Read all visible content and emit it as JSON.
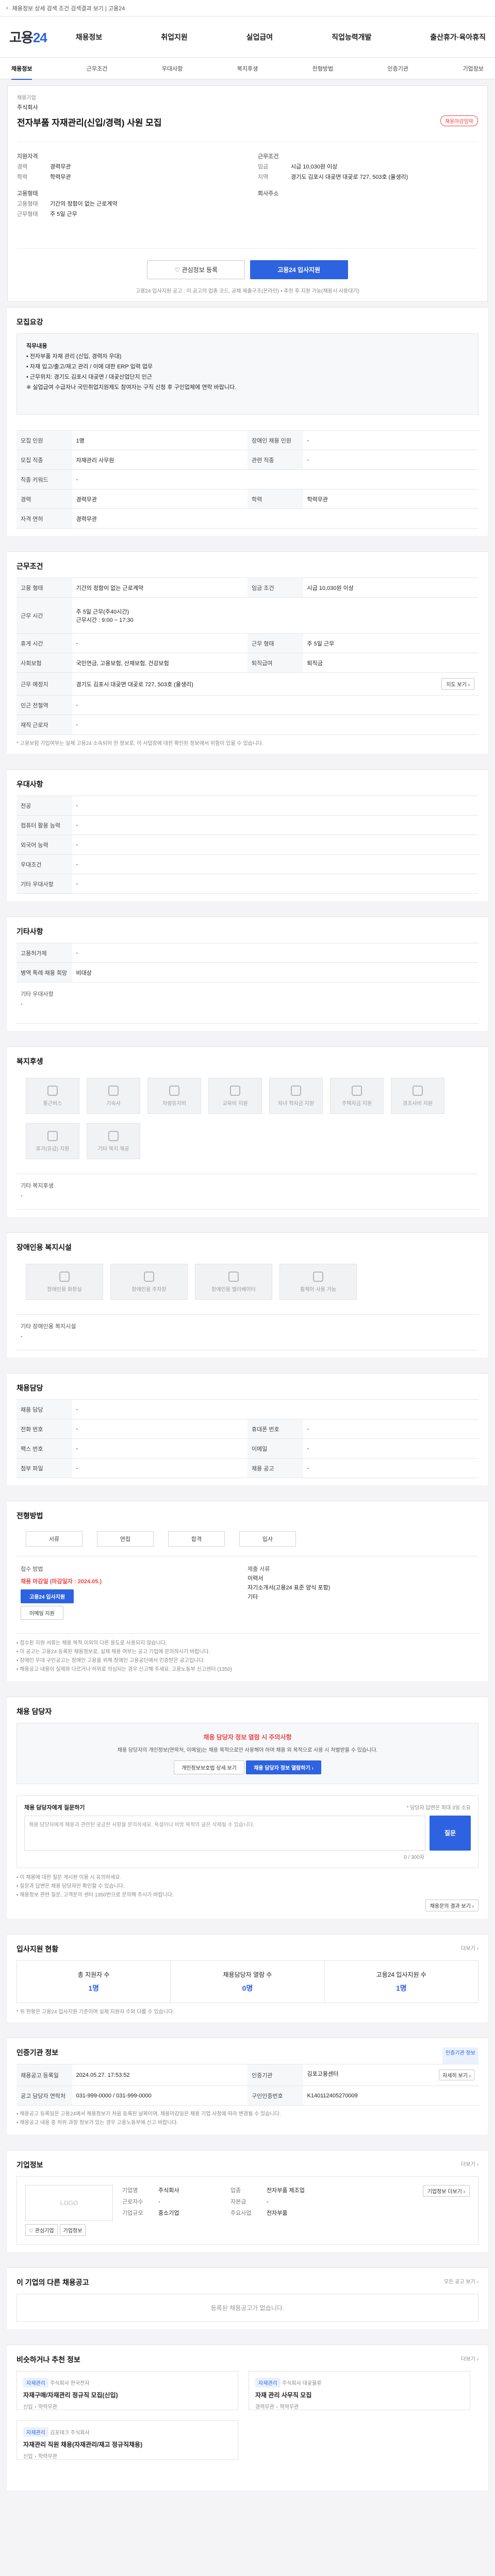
{
  "topbar": {
    "text": "채용정보 상세 검색 조건 검색결과 보기 | 고용24",
    "back": "‹"
  },
  "header": {
    "logo_a": "고용",
    "logo_b": "24",
    "menu": [
      "채용정보",
      "취업지원",
      "실업급여",
      "직업능력개발",
      "출산휴가·육아휴직"
    ]
  },
  "tabs": [
    "채용정보",
    "근무조건",
    "우대사항",
    "복지후생",
    "전형방법",
    "인증기관",
    "기업정보"
  ],
  "post": {
    "company_label": "채용기업",
    "company_name": "주식회사",
    "title": "전자부품 자재관리(신입/경력) 사원 모집",
    "badge": "채용마감임박",
    "left": [
      {
        "k": "지원자격",
        "v": ""
      },
      {
        "k": "경력",
        "v": "경력무관"
      },
      {
        "k": "학력",
        "v": "학력무관"
      },
      {
        "k": "고용형태",
        "v": ""
      },
      {
        "k": "고용형태",
        "v": "기간의 정함이 없는 근로계약"
      },
      {
        "k": "근무형태",
        "v": "주 5일 근무"
      }
    ],
    "right": [
      {
        "k": "근무조건",
        "v": ""
      },
      {
        "k": "임금",
        "v": "시급 10,030원 이상"
      },
      {
        "k": "지역",
        "v": "경기도 김포시 대곶면 대곶로 727, 503호 (율생리)"
      },
      {
        "k": "회사주소",
        "v": ""
      }
    ],
    "scrap": "♡ 관심정보 등록",
    "apply": "고용24 입사지원",
    "notice": "고용24 입사지원 공고 : 이 공고의 업종 코드, 공채 제출구조(온라인) • 추천 후 지원 가능(채용시 사용대기)"
  },
  "recruit": {
    "title": "모집요강",
    "box_title": "직무내용",
    "box_lines": [
      "• 전자부품 자재 관리 (신입, 경력자 우대)",
      "• 자재 입고/출고/재고 관리 / 이에 대한 ERP 입력 업무",
      "• 근무위치: 경기도 김포시 대곶면 / 대곶산업단지 인근",
      "※ 실업급여 수급자나 국민취업지원제도 참여자는 구직 신청 후 구인업체에 연락 바랍니다."
    ],
    "rows": [
      [
        {
          "k": "모집 인원",
          "v": "1명"
        },
        {
          "k": "장애인 채용 인원",
          "v": "-"
        }
      ],
      [
        {
          "k": "모집 직종",
          "v": "자재관리 사무원"
        },
        {
          "k": "관련 직종",
          "v": "-"
        }
      ],
      [
        {
          "k": "직종 키워드",
          "v": "-"
        },
        {
          "k": "",
          "v": ""
        }
      ],
      [
        {
          "k": "경력",
          "v": "경력무관"
        },
        {
          "k": "학력",
          "v": "학력무관"
        }
      ],
      [
        {
          "k": "자격 면허",
          "v": "경력무관"
        },
        {
          "k": "",
          "v": ""
        }
      ]
    ]
  },
  "work": {
    "title": "근무조건",
    "rows": [
      [
        {
          "k": "고용 형태",
          "v": "기간의 정함이 없는 근로계약"
        },
        {
          "k": "임금 조건",
          "v": "시급 10,030원 이상"
        }
      ],
      [
        {
          "k": "근무 시간",
          "v": "주 5일 근무(주40시간)\n근무시간 : 9:00 ~ 17:30"
        },
        {
          "k": "",
          "v": ""
        }
      ],
      [
        {
          "k": "휴게 시간",
          "v": "-"
        },
        {
          "k": "근무 형태",
          "v": "주 5일 근무"
        }
      ],
      [
        {
          "k": "사회보험",
          "v": "국민연금, 고용보험, 산재보험, 건강보험"
        },
        {
          "k": "퇴직급여",
          "v": "퇴직금"
        }
      ],
      [
        {
          "k": "근무 예정지",
          "v": "경기도 김포시 대곶면 대곶로 727, 503호 (율생리)"
        },
        {
          "k": "",
          "v": ""
        }
      ],
      [
        {
          "k": "인근 전철역",
          "v": "-"
        },
        {
          "k": "",
          "v": ""
        }
      ],
      [
        {
          "k": "재직 근로자",
          "v": "-"
        },
        {
          "k": "",
          "v": ""
        }
      ]
    ],
    "map_btn": "지도 보기 ›",
    "note": "* 고용보험 가입여부는 실제 고용24 소속되어 한 정보로, 이 사업장에 대한 확인된 정보에서 위험이 있을 수 있습니다."
  },
  "pref": {
    "title": "우대사항",
    "rows": [
      {
        "k": "전공",
        "v": "-"
      },
      {
        "k": "컴퓨터 활용 능력",
        "v": "-"
      },
      {
        "k": "외국어 능력",
        "v": "-"
      },
      {
        "k": "우대조건",
        "v": "-"
      },
      {
        "k": "기타 우대사항",
        "v": "-"
      }
    ]
  },
  "etc": {
    "title": "기타사항",
    "rows": [
      {
        "k": "고용허가제",
        "v": "-"
      },
      {
        "k": "병역 특례 채용 희망",
        "v": "비대상"
      }
    ],
    "extra_label": "기타 우대사항",
    "extra_value": "-"
  },
  "welfare": {
    "title": "복지후생",
    "icons": [
      "통근버스",
      "기숙사",
      "차량유지비",
      "교육비 지원",
      "자녀 학자금 지원",
      "주택자금 지원",
      "경조사비 지원",
      "휴가(유급) 지원",
      "기타 복지 제공"
    ],
    "other_label": "기타 복지후생",
    "other_value": "-"
  },
  "disability": {
    "title": "장애인용 복지시설",
    "icons": [
      "장애인용 화장실",
      "장애인용 주차장",
      "장애인용 엘리베이터",
      "휠체어 사용 가능",
      "장애인용 편의시설"
    ],
    "other_label": "기타 장애인용 복지시설",
    "other_value": "-"
  },
  "manager": {
    "title": "채용담당",
    "rows": [
      [
        {
          "k": "채용 담당",
          "v": "-"
        },
        {
          "k": "",
          "v": ""
        }
      ],
      [
        {
          "k": "전화 번호",
          "v": "-"
        },
        {
          "k": "휴대폰 번호",
          "v": "-"
        }
      ],
      [
        {
          "k": "팩스 번호",
          "v": "-"
        },
        {
          "k": "이메일",
          "v": "-"
        }
      ],
      [
        {
          "k": "첨부 파일",
          "v": "-"
        },
        {
          "k": "채용 공고",
          "v": "-"
        }
      ]
    ]
  },
  "selection": {
    "title": "전형방법",
    "steps": [
      "서류",
      "면접",
      "합격",
      "입사"
    ],
    "method_label": "접수 방법",
    "method_title": "채용 마감일 (마감일자 : 2024.05.)",
    "method_btn1": "고용24 입사지원",
    "method_btn2": "이메일 지원",
    "docs_label": "제출 서류",
    "docs_lines": [
      "이력서",
      "자기소개서(고용24 표준 양식 포함)",
      "기타"
    ],
    "bullets": [
      "• 접수된 지원 서류는 채용 목적 이외의 다른 용도로 사용되지 않습니다.",
      "• 이 공고는 고용24 등록된 채용정보로, 실제 채용 여부는 공고 기업에 문의하시기 바랍니다.",
      "• 장애인 우대 구인공고는 장애인 고용을 위해 장애인 고용공단에서 인증받은 공고입니다.",
      "• 채용공고 내용이 실제와 다르거나 허위로 의심되는 경우 신고해 주세요. 고용노동부 신고센터 (1350)"
    ]
  },
  "inquiry": {
    "title": "채용 담당자",
    "alert_title": "채용 담당자 정보 열람 시 주의사항",
    "alert_body": "채용 담당자의 개인정보(연락처, 이메일)는 채용 목적으로만 사용해야 하며 채용 외 목적으로 사용 시 처벌받을 수 있습니다.",
    "btn_left": "개인정보보호법 상세 보기",
    "btn_right": "채용 담당자 정보 열람하기 ›",
    "ask_label": "채용 담당자에게 질문하기",
    "ask_hint": "* 담당자 답변은 최대 3일 소요",
    "ask_placeholder": "채용 담당자에게 채용과 관련된 궁금한 사항을 문의하세요. 욕설이나 비방 목적의 글은 삭제될 수 있습니다.",
    "ask_count": "0 / 300자",
    "ask_submit": "질문",
    "notes": [
      "• 이 채용에 대한 질문 게시판 이용 시 유의하세요.",
      "• 질문과 답변은 채용 담당자만 확인할 수 있습니다.",
      "• 채용정보 관련 질문, 고객문의 센터 1350번으로 문의해 주시기 바랍니다."
    ],
    "more": "채용문의 결과 보기 ›"
  },
  "status": {
    "title": "입사지원 현황",
    "more": "더보기 ›",
    "items": [
      {
        "k": "총 지원자 수",
        "v": "1명"
      },
      {
        "k": "채용담당자 열람 수",
        "v": "0명"
      },
      {
        "k": "고용24 입사지원 수",
        "v": "1명"
      }
    ],
    "note": "* 위 현황은 고용24 입사지원 기준이며 실제 지원자 수와 다를 수 있습니다."
  },
  "cert": {
    "title": "인증기관 정보",
    "badge": "인증기관 정보",
    "rows": [
      [
        {
          "k": "채용공고 등록일",
          "v": "2024.05.27. 17:53:52"
        },
        {
          "k": "인증기관",
          "v": "김포고용센터"
        }
      ],
      [
        {
          "k": "공고 담당자 연락처",
          "v": "031-999-0000 / 031-999-0000"
        },
        {
          "k": "구인인증번호",
          "v": "K140112405270009"
        }
      ]
    ],
    "more": "자세히 보기 ›",
    "notes": [
      "• 채용공고 등록일은 고용24에서 채용정보가 처음 등록된 날짜이며, 채용마감일은 채용 기업 사정에 따라 변경될 수 있습니다.",
      "• 채용공고 내용 중 허위·과장 정보가 있는 경우 고용노동부에 신고 바랍니다."
    ]
  },
  "company": {
    "title": "기업정보",
    "more": "더보기 ›",
    "logo": "LOGO",
    "btn_a": "♡ 관심기업",
    "btn_b": "기업정보",
    "rows": [
      [
        {
          "k": "기업명",
          "v": "주식회사"
        },
        {
          "k": "업종",
          "v": "전자부품 제조업"
        }
      ],
      [
        {
          "k": "근로자수",
          "v": "-"
        },
        {
          "k": "자본금",
          "v": "-"
        }
      ],
      [
        {
          "k": "기업규모",
          "v": "중소기업"
        },
        {
          "k": "주요사업",
          "v": "전자부품"
        }
      ]
    ],
    "side_btn": "기업정보 더보기 ›"
  },
  "other": {
    "title": "이 기업의 다른 채용공고",
    "more": "모든 공고 보기 ›",
    "empty": "등록된 채용공고가 없습니다."
  },
  "recs": {
    "title": "비슷하거나 추천 정보",
    "more": "더보기 ›",
    "items": [
      {
        "tag": "자재관리",
        "company": "주식회사 한국전자",
        "title": "자재구매/자재관리 정규직 모집(신입)",
        "a": "신입",
        "b": "학력무관"
      },
      {
        "tag": "자재관리",
        "company": "주식회사 대곶물류",
        "title": "자재 관리 사무직 모집",
        "a": "경력무관",
        "b": "학력무관"
      },
      {
        "tag": "자재관리",
        "company": "김포테크 주식회사",
        "title": "자재관리 직원 채용(자재관리/재고 정규직채용)",
        "a": "신입",
        "b": "학력무관"
      }
    ]
  }
}
